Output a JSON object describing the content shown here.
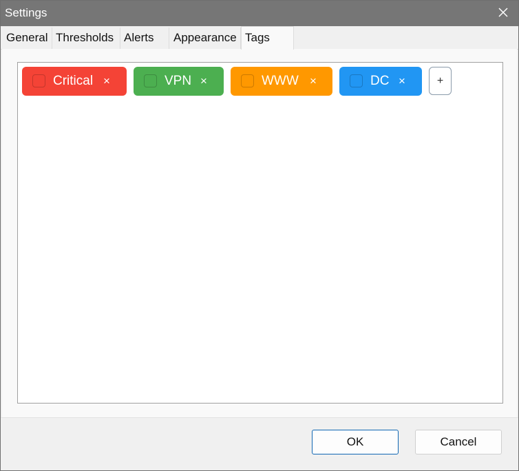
{
  "window": {
    "title": "Settings"
  },
  "tabs": [
    {
      "label": "General"
    },
    {
      "label": "Thresholds"
    },
    {
      "label": "Alerts"
    },
    {
      "label": "Appearance"
    },
    {
      "label": "Tags",
      "active": true
    }
  ],
  "tags": [
    {
      "label": "Critical",
      "color": "#f44336",
      "remove": "×",
      "icon": "tag-color-swatch"
    },
    {
      "label": "VPN",
      "color": "#4caf50",
      "remove": "×",
      "icon": "tag-color-swatch"
    },
    {
      "label": "WWW",
      "color": "#ff9800",
      "remove": "×",
      "icon": "tag-color-swatch"
    },
    {
      "label": "DC",
      "color": "#2196f3",
      "remove": "×",
      "icon": "tag-color-swatch"
    }
  ],
  "add_tag": {
    "label": "+"
  },
  "footer": {
    "ok_label": "OK",
    "cancel_label": "Cancel"
  },
  "colors": {
    "titlebar": "#767676",
    "ok_border": "#0f66b3"
  }
}
